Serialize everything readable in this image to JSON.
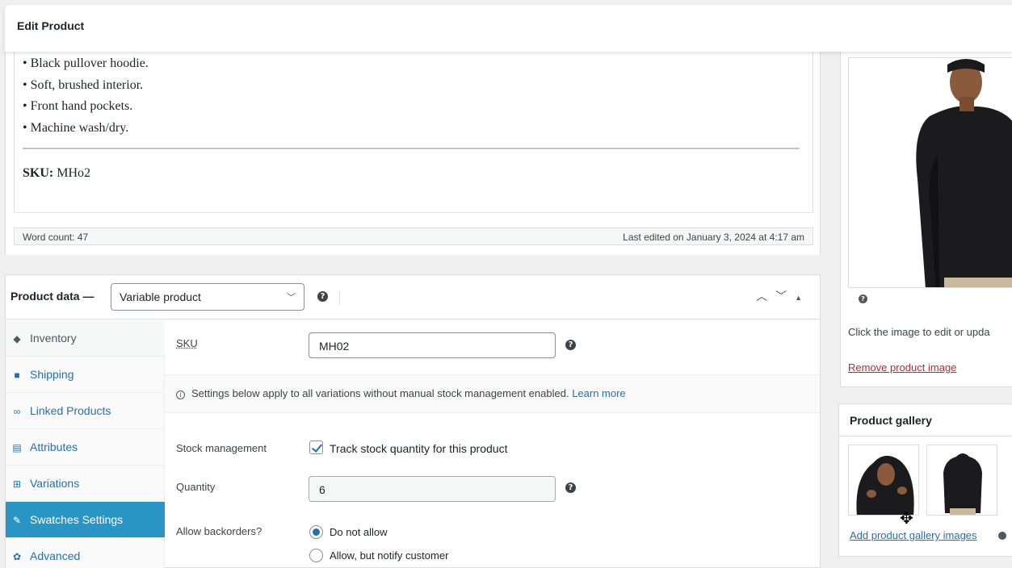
{
  "header": {
    "title": "Edit Product"
  },
  "editor": {
    "bullets": [
      "• Black pullover hoodie.",
      "• Soft, brushed interior.",
      "• Front hand pockets.",
      "• Machine wash/dry."
    ],
    "sku_label": "SKU:",
    "sku_value": "MHo2",
    "word_count": "Word count: 47",
    "last_edited": "Last edited on January 3, 2024 at 4:17 am"
  },
  "product_data": {
    "label": "Product data —",
    "type_selected": "Variable product",
    "help_glyph": "?",
    "tabs": [
      {
        "label": "Inventory",
        "icon": "tag-icon",
        "glyph": "◆"
      },
      {
        "label": "Shipping",
        "icon": "truck-icon",
        "glyph": "■"
      },
      {
        "label": "Linked Products",
        "icon": "link-icon",
        "glyph": "∞"
      },
      {
        "label": "Attributes",
        "icon": "list-icon",
        "glyph": "▤"
      },
      {
        "label": "Variations",
        "icon": "grid-icon",
        "glyph": "⊞"
      },
      {
        "label": "Swatches Settings",
        "icon": "wrench-icon",
        "glyph": "✎"
      },
      {
        "label": "Advanced",
        "icon": "gear-icon",
        "glyph": "✿"
      }
    ],
    "sku": {
      "label": "SKU",
      "value": "MH02"
    },
    "notice": {
      "text": "Settings below apply to all variations without manual stock management enabled.",
      "link": "Learn more"
    },
    "stock_management": {
      "label": "Stock management",
      "checkbox_label": "Track stock quantity for this product",
      "checked": true
    },
    "quantity": {
      "label": "Quantity",
      "value": "6"
    },
    "backorders": {
      "label": "Allow backorders?",
      "options": [
        "Do not allow",
        "Allow, but notify customer"
      ],
      "selected": "Do not allow"
    }
  },
  "featured_image": {
    "help": "?",
    "hint": "Click the image to edit or upda",
    "remove": "Remove product image"
  },
  "gallery": {
    "title": "Product gallery",
    "add": "Add product gallery images"
  },
  "colors": {
    "accent": "#2271b1",
    "active_tab": "#2a95c5",
    "danger": "#b32d2e"
  }
}
